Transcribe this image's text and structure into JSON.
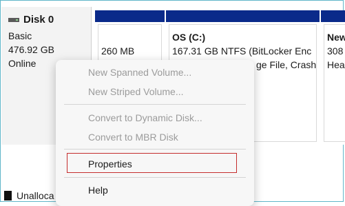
{
  "disk": {
    "name": "Disk 0",
    "type": "Basic",
    "size": "476.92 GB",
    "status": "Online"
  },
  "partitions": [
    {
      "size": "260 MB"
    },
    {
      "title": "OS  (C:)",
      "line1": "167.31 GB NTFS (BitLocker Enc",
      "line2": "ge File, Crash"
    },
    {
      "title": "New",
      "line1": "308",
      "line2": "Hea"
    }
  ],
  "legend": {
    "unallocated": "Unalloca"
  },
  "menu": {
    "items": [
      {
        "label": "New Spanned Volume...",
        "enabled": false
      },
      {
        "label": "New Striped Volume...",
        "enabled": false
      },
      {
        "label": "Convert to Dynamic Disk...",
        "enabled": false
      },
      {
        "label": "Convert to MBR Disk",
        "enabled": false
      },
      {
        "label": "Properties",
        "enabled": true
      },
      {
        "label": "Help",
        "enabled": true
      }
    ]
  },
  "colors": {
    "partition_bar": "#0a2a8a",
    "highlight_border": "#c42b2b",
    "frame": "#5fb6c9"
  }
}
